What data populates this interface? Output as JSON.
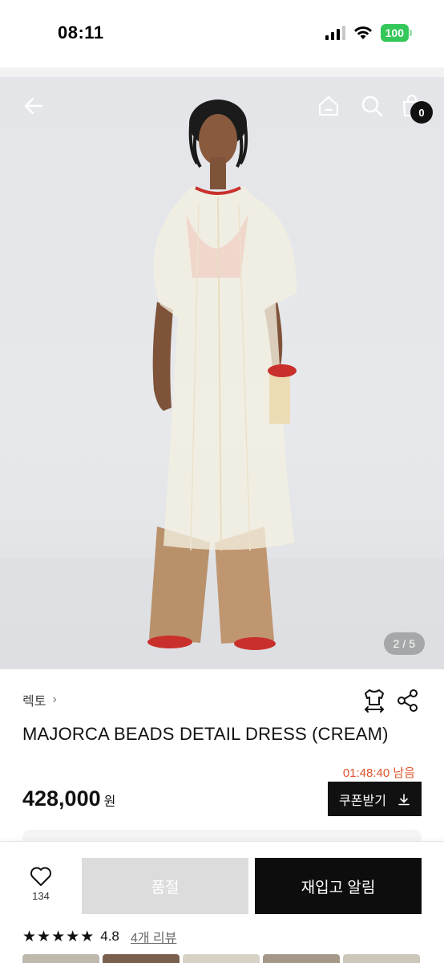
{
  "status_bar": {
    "time": "08:11",
    "battery": "100"
  },
  "hero": {
    "page_current": "2",
    "page_separator": "/",
    "page_total": "5",
    "cart_count": "0",
    "icons": [
      "back-arrow-icon",
      "home-icon",
      "search-icon",
      "shopping-bag-icon"
    ]
  },
  "product": {
    "brand": "렉토",
    "title": "MAJORCA BEADS DETAIL DRESS (CREAM)",
    "timer": "01:48:40 남음",
    "price": "428,000",
    "price_unit": "원",
    "coupon_label": "쿠폰받기"
  },
  "actions": {
    "like_count": "134",
    "soldout_label": "품절",
    "restock_label": "재입고 알림"
  },
  "rating": {
    "value": "4.8",
    "stars": 5,
    "review_link": "4개 리뷰"
  },
  "colors": {
    "accent_timer": "#e0522b",
    "primary_button": "#0d0d0d",
    "disabled_button": "#dcdcdc",
    "battery": "#34c759"
  }
}
